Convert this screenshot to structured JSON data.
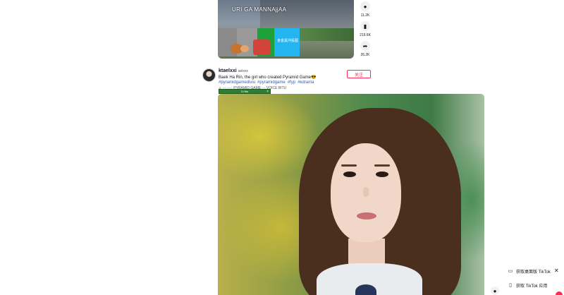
{
  "prev_video": {
    "caption": "URI GA MANNAjjAA",
    "panel_label": "食金黑冲投图"
  },
  "prev_actions": [
    {
      "icon": "comment-icon",
      "count": "11.2K"
    },
    {
      "icon": "bookmark-icon",
      "count": "219.6K"
    },
    {
      "icon": "share-icon",
      "count": "26.2K"
    }
  ],
  "post": {
    "username": "ktaelxxi",
    "nickname": "aelxxx",
    "description": "Baek Ha Rin, the girl who created Pyramid Game😎",
    "hashtags": [
      "#pyramidgamediviu",
      "#pyramidgame",
      "#fyp",
      "#kdrama"
    ],
    "music": "♫ ··· ·····  PYRAMID GAME ··· VOICE BITU",
    "follow_label": "关注",
    "mini_bar_label": "3 Hits"
  },
  "get_app": {
    "desktop_label": "获取桌面版 TikTok",
    "app_label": "获取 TikTok 应用"
  }
}
